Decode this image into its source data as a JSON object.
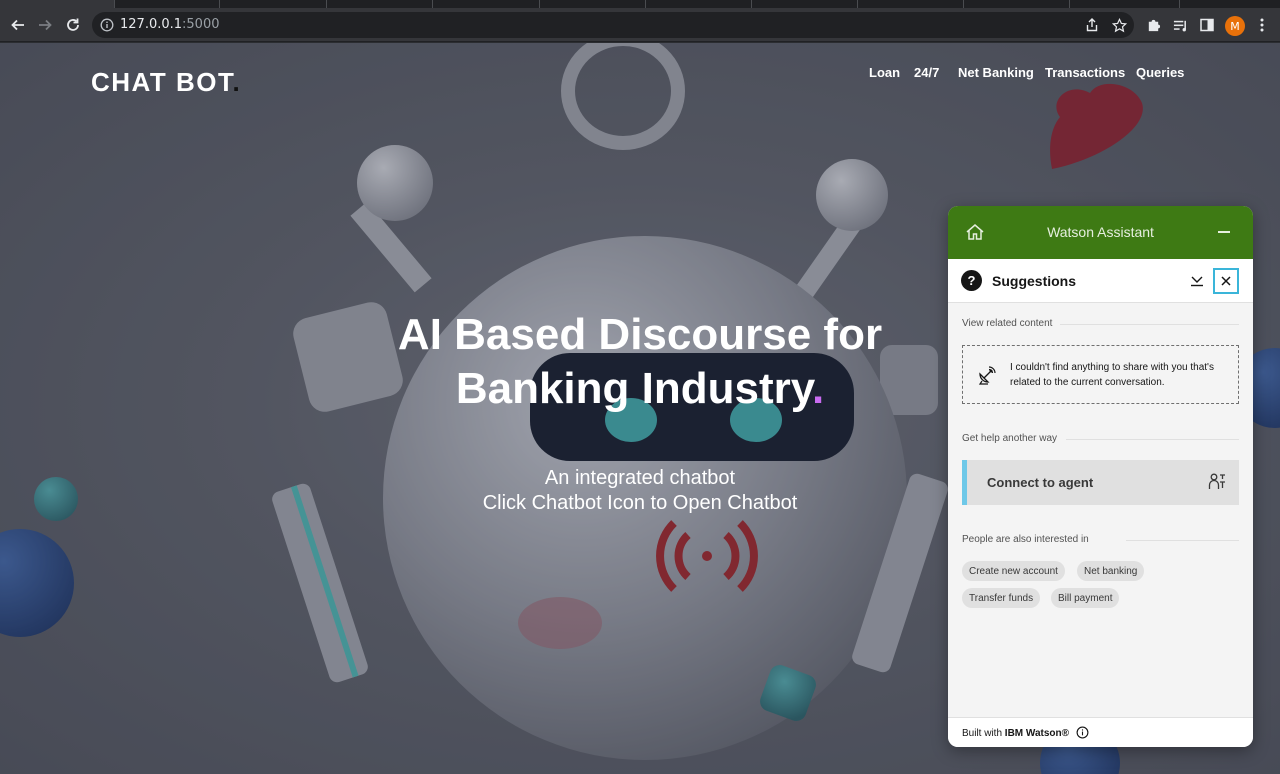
{
  "browser": {
    "url_host": "127.0.0.1",
    "url_port": ":5000",
    "profile_initial": "M"
  },
  "site": {
    "brand": "CHAT BOT",
    "brand_dot": ".",
    "nav": [
      "Loan",
      "24/7",
      "Net Banking",
      "Transactions",
      "Queries"
    ],
    "hero_line1": "AI Based Discourse for",
    "hero_line2": "Banking Industry",
    "hero_dot": ".",
    "sub_line1": "An integrated chatbot",
    "sub_line2": "Click Chatbot Icon to Open Chatbot"
  },
  "watson": {
    "title": "Watson Assistant",
    "suggestions_label": "Suggestions",
    "question_mark": "?",
    "section_related": "View related content",
    "no_content_message": "I couldn't find anything to share with you that's related to the current conversation.",
    "section_help": "Get help another way",
    "connect_agent": "Connect to agent",
    "section_interested": "People are also interested in",
    "chips": [
      "Create new account",
      "Net banking",
      "Transfer funds",
      "Bill payment"
    ],
    "footer_prefix": "Built with ",
    "footer_brand": "IBM Watson®"
  },
  "colors": {
    "watson_header": "#3e7a14",
    "agent_accent": "#6ec8e8",
    "hero_dot": "#c86bf0",
    "close_focus": "#3ab5d9"
  }
}
